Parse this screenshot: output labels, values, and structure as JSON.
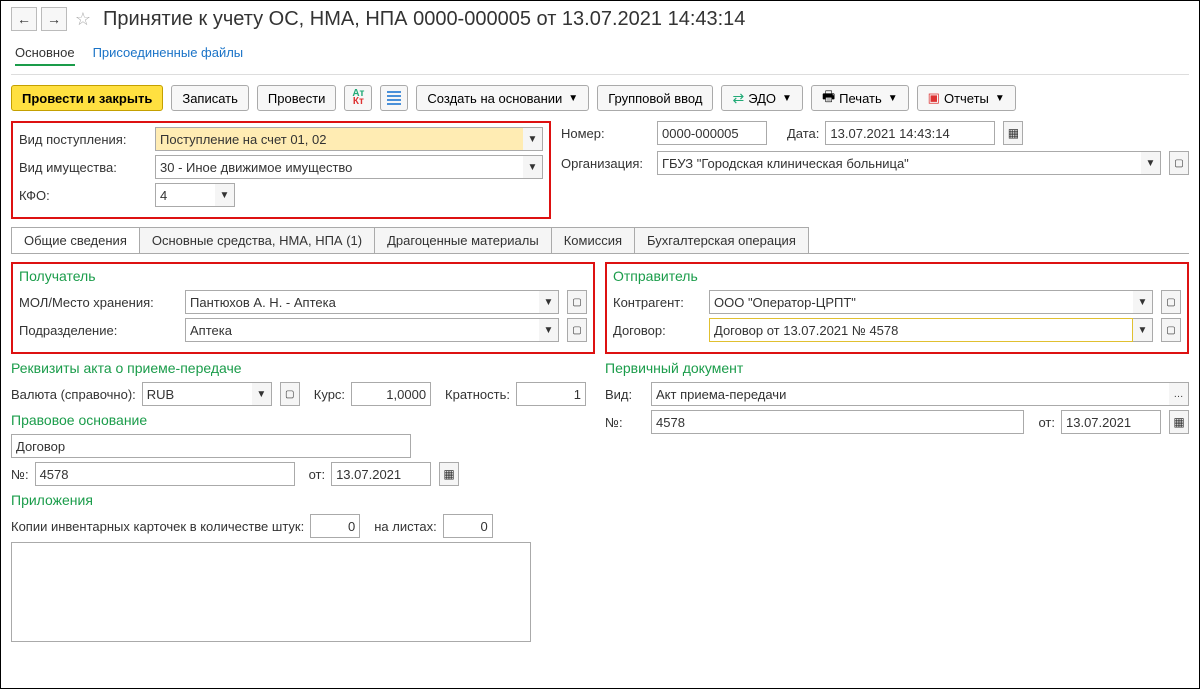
{
  "header": {
    "title": "Принятие к учету ОС, НМА, НПА 0000-000005 от 13.07.2021 14:43:14"
  },
  "subnav": {
    "main": "Основное",
    "attached": "Присоединенные файлы"
  },
  "toolbar": {
    "post_close": "Провести и закрыть",
    "save": "Записать",
    "post": "Провести",
    "create_based": "Создать на основании",
    "group_input": "Групповой ввод",
    "edo": "ЭДО",
    "print": "Печать",
    "reports": "Отчеты"
  },
  "form": {
    "receipt_type_label": "Вид поступления:",
    "receipt_type": "Поступление на счет 01, 02",
    "property_type_label": "Вид имущества:",
    "property_type": "30 - Иное движимое имущество",
    "kfo_label": "КФО:",
    "kfo": "4",
    "number_label": "Номер:",
    "number": "0000-000005",
    "date_label": "Дата:",
    "date": "13.07.2021 14:43:14",
    "org_label": "Организация:",
    "org": "ГБУЗ \"Городская клиническая больница\""
  },
  "tabs": [
    "Общие сведения",
    "Основные средства, НМА, НПА (1)",
    "Драгоценные материалы",
    "Комиссия",
    "Бухгалтерская операция"
  ],
  "recipient": {
    "title": "Получатель",
    "mol_label": "МОЛ/Место хранения:",
    "mol": "Пантюхов А. Н. - Аптека",
    "dept_label": "Подразделение:",
    "dept": "Аптека"
  },
  "sender": {
    "title": "Отправитель",
    "counterparty_label": "Контрагент:",
    "counterparty": "ООО \"Оператор-ЦРПТ\"",
    "contract_label": "Договор:",
    "contract": "Договор от 13.07.2021 № 4578"
  },
  "act": {
    "title": "Реквизиты акта о приеме-передаче",
    "currency_label": "Валюта (справочно):",
    "currency": "RUB",
    "rate_label": "Курс:",
    "rate": "1,0000",
    "mult_label": "Кратность:",
    "mult": "1"
  },
  "legal": {
    "title": "Правовое основание",
    "basis": "Договор",
    "num_label": "№:",
    "num": "4578",
    "from_label": "от:",
    "from": "13.07.2021"
  },
  "attachments": {
    "title": "Приложения",
    "copies_label": "Копии инвентарных карточек в количестве штук:",
    "copies": "0",
    "sheets_label": "на листах:",
    "sheets": "0"
  },
  "primary_doc": {
    "title": "Первичный документ",
    "type_label": "Вид:",
    "type": "Акт приема-передачи",
    "num_label": "№:",
    "num": "4578",
    "from_label": "от:",
    "from": "13.07.2021"
  }
}
